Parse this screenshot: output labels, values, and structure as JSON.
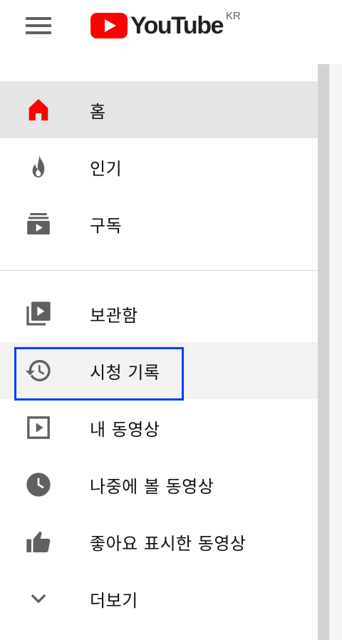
{
  "header": {
    "logo_text": "YouTube",
    "country_code": "KR",
    "brand_color": "#ff0000"
  },
  "guide": {
    "primary": [
      {
        "label": "홈",
        "icon": "home-icon",
        "state": "selected"
      },
      {
        "label": "인기",
        "icon": "trending-fire-icon"
      },
      {
        "label": "구독",
        "icon": "subscriptions-icon"
      }
    ],
    "library": [
      {
        "label": "보관함",
        "icon": "library-icon"
      },
      {
        "label": "시청 기록",
        "icon": "history-icon",
        "state": "focused"
      },
      {
        "label": "내 동영상",
        "icon": "my-videos-icon"
      },
      {
        "label": "나중에 볼 동영상",
        "icon": "watch-later-icon"
      },
      {
        "label": "좋아요 표시한 동영상",
        "icon": "liked-videos-icon"
      },
      {
        "label": "더보기",
        "icon": "chevron-down-icon"
      }
    ]
  },
  "colors": {
    "icon_gray": "#606060",
    "selected_bg": "#e5e5e5",
    "focus_outline": "#0a3cff"
  }
}
